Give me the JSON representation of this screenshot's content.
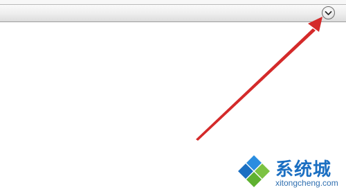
{
  "toolbar": {
    "expand_button_icon": "chevron-down-icon"
  },
  "annotation": {
    "arrow_color": "#d42a2a"
  },
  "watermark": {
    "brand_text": "系统城",
    "domain_text": "xitongcheng.com",
    "brand_color": "#1b6fc2",
    "logo_colors": [
      "#2a8de0",
      "#7cc242",
      "#1b6fc2",
      "#5fb130"
    ]
  }
}
